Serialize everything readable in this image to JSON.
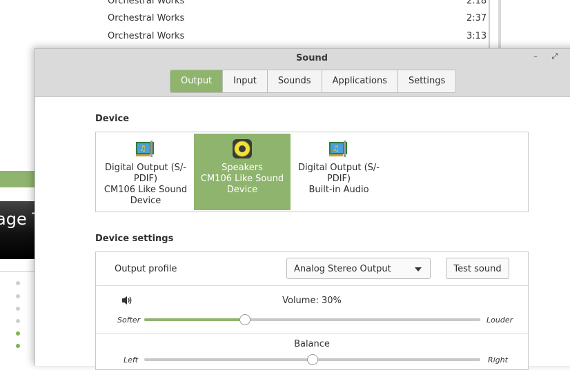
{
  "background": {
    "tracks": [
      {
        "name": "Orchestral Works",
        "time": "2:18"
      },
      {
        "name": "Orchestral Works",
        "time": "2:37"
      },
      {
        "name": "Orchestral Works",
        "time": "3:13"
      }
    ],
    "side_text": "age T"
  },
  "dialog": {
    "title": "Sound",
    "tabs": [
      {
        "label": "Output",
        "active": true
      },
      {
        "label": "Input",
        "active": false
      },
      {
        "label": "Sounds",
        "active": false
      },
      {
        "label": "Applications",
        "active": false
      },
      {
        "label": "Settings",
        "active": false
      }
    ],
    "device_heading": "Device",
    "devices": [
      {
        "label": "Digital Output (S/-PDIF)\nCM106 Like Sound Device",
        "icon": "sound-card-icon",
        "selected": false
      },
      {
        "label": "Speakers\nCM106 Like Sound Device",
        "icon": "speaker-icon",
        "selected": true
      },
      {
        "label": "Digital Output (S/-PDIF)\nBuilt-in Audio",
        "icon": "sound-card-icon",
        "selected": false
      }
    ],
    "settings_heading": "Device settings",
    "output_profile_label": "Output profile",
    "output_profile_value": "Analog Stereo Output",
    "test_sound_label": "Test sound",
    "volume_label": "Volume: 30%",
    "volume_value": 0.3,
    "softer_label": "Softer",
    "louder_label": "Louder",
    "balance_label": "Balance",
    "balance_value": 0.5,
    "balance_left_label": "Left",
    "balance_right_label": "Right"
  },
  "colors": {
    "accent": "#8fb46e",
    "titlebar": "#dadada"
  }
}
